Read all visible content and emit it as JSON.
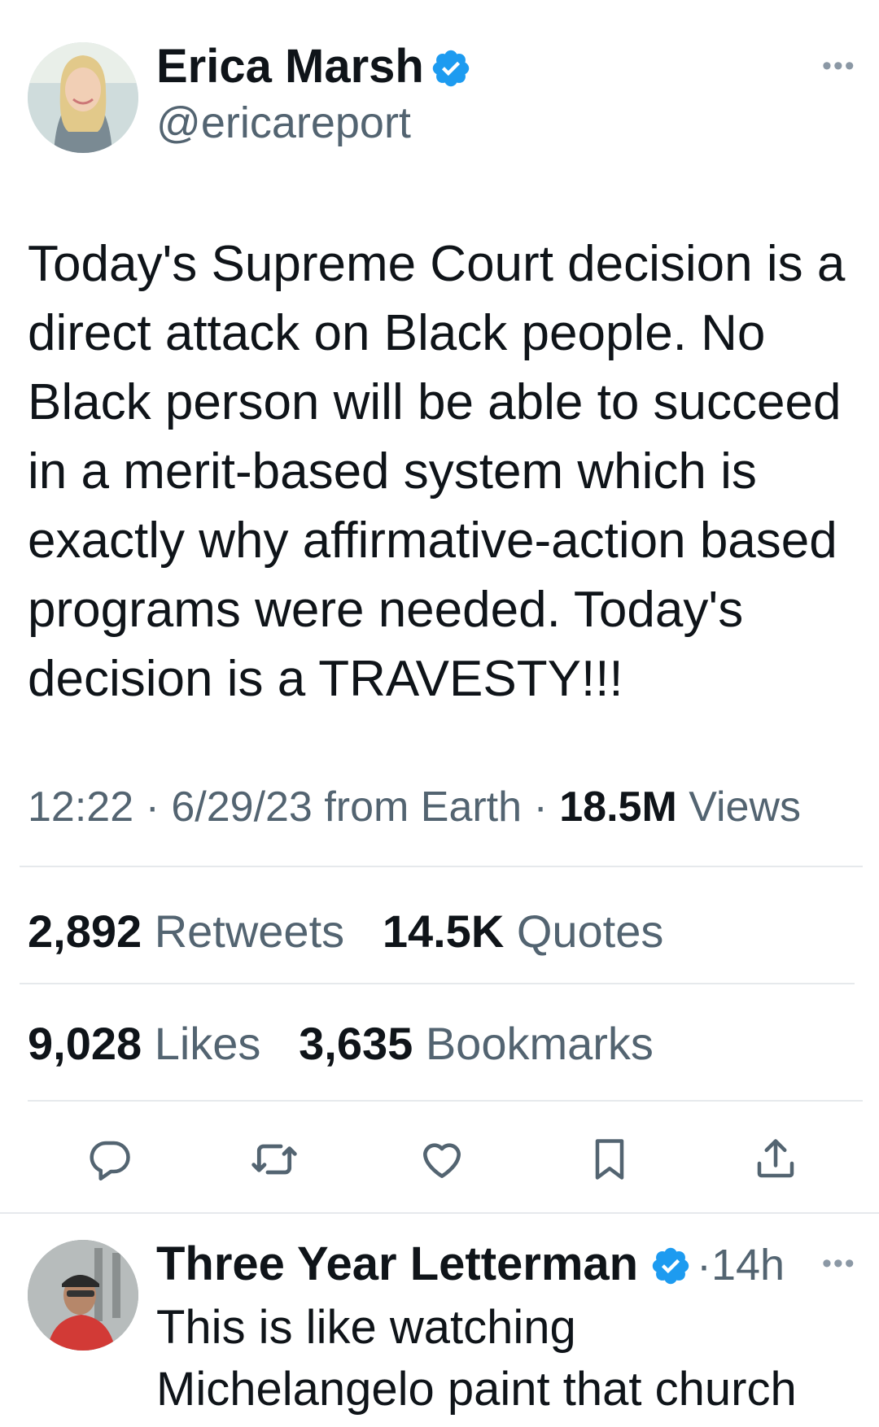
{
  "tweet": {
    "author_name": "Erica Marsh",
    "author_handle": "@ericareport",
    "more_label": "•••",
    "text": "Today's Supreme Court decision is a direct attack on Black people. No Black person will be able to succeed in a merit-based system which is exactly why affirmative-action based programs were needed. Today's decision is a TRAVESTY!!!",
    "time": "12:22",
    "date": "6/29/23",
    "source": "from Earth",
    "views_count": "18.5M",
    "views_label": "Views",
    "retweets_count": "2,892",
    "retweets_label": "Retweets",
    "quotes_count": "14.5K",
    "quotes_label": "Quotes",
    "likes_count": "9,028",
    "likes_label": "Likes",
    "bookmarks_count": "3,635",
    "bookmarks_label": "Bookmarks"
  },
  "actions": [
    "reply-icon",
    "retweet-icon",
    "like-icon",
    "bookmark-icon",
    "share-icon"
  ],
  "reply": {
    "author_name": "Three Year Letterman",
    "time_ago": "14h",
    "more_label": "•••",
    "text_line1": "This is like watching",
    "text_line2": "Michelangelo paint that church"
  },
  "colors": {
    "verified": "#1d9bf0",
    "text": "#0f1419",
    "secondary": "#536471",
    "divider": "#e6e9ec"
  }
}
